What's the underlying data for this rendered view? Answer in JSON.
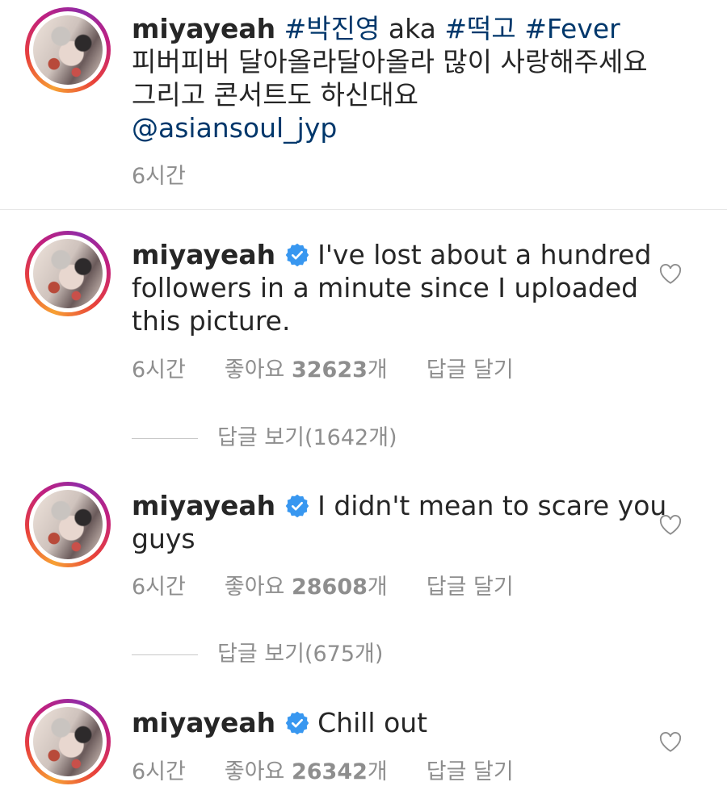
{
  "caption": {
    "username": "miyayeah",
    "line1_tags": [
      "#박진영",
      "aka",
      "#떡고",
      "#Fever"
    ],
    "line2": "피버피버 달아올라달아올라 많이 사랑해주세요",
    "line3": "그리고 콘서트도 하신대요",
    "mention": "@asiansoul_jyp",
    "time": "6시간"
  },
  "comments": [
    {
      "username": "miyayeah",
      "text_lines": [
        "I've lost about a hundred",
        "followers in a minute since I uploaded",
        "this picture."
      ],
      "time": "6시간",
      "likes_label": "좋아요",
      "likes_count": "32623",
      "likes_unit": "개",
      "reply_label": "답글 달기",
      "view_replies": "답글 보기(1642개)"
    },
    {
      "username": "miyayeah",
      "text_lines": [
        "I didn't mean to scare you",
        "guys"
      ],
      "time": "6시간",
      "likes_label": "좋아요",
      "likes_count": "28608",
      "likes_unit": "개",
      "reply_label": "답글 달기",
      "view_replies": "답글 보기(675개)"
    },
    {
      "username": "miyayeah",
      "text_lines": [
        "Chill out"
      ],
      "time": "6시간",
      "likes_label": "좋아요",
      "likes_count": "26342",
      "likes_unit": "개",
      "reply_label": "답글 달기"
    }
  ],
  "colors": {
    "verified": "#3897f0",
    "hashtag": "#00376b",
    "meta_gray": "#8e8e8e"
  },
  "icons": {
    "verified": "verified-badge-icon",
    "like": "heart-outline-icon"
  }
}
